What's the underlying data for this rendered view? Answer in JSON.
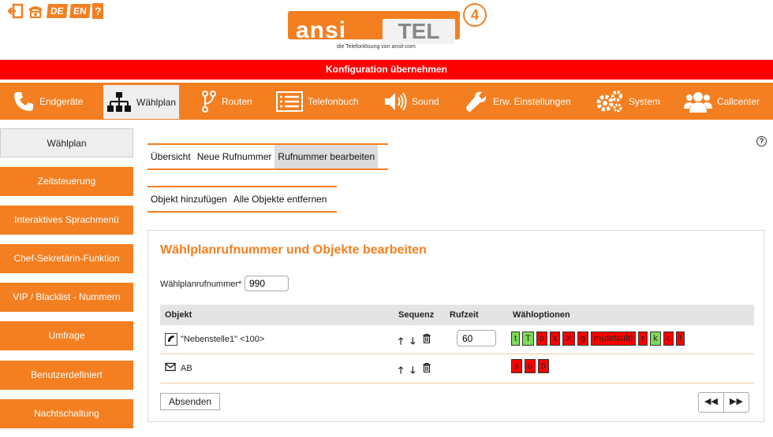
{
  "top_icons": {
    "lang_de": "DE",
    "lang_en": "EN",
    "help": "?"
  },
  "logo": {
    "ansi": "ansi",
    "tel": "TEL",
    "version": "4",
    "subline": "die Telefonlösung von ansit-com"
  },
  "apply_bar": "Konfiguration übernehmen",
  "nav": [
    {
      "label": "Endgeräte",
      "icon": "phone-icon"
    },
    {
      "label": "Wählplan",
      "icon": "hierarchy-icon"
    },
    {
      "label": "Routen",
      "icon": "route-icon"
    },
    {
      "label": "Telefonbuch",
      "icon": "list-icon"
    },
    {
      "label": "Sound",
      "icon": "speaker-icon"
    },
    {
      "label": "Erw. Einstellungen",
      "icon": "wrench-icon"
    },
    {
      "label": "System",
      "icon": "gears-icon"
    },
    {
      "label": "Callcenter",
      "icon": "users-icon"
    }
  ],
  "sidebar": [
    "Wählplan",
    "Zeitsteuerung",
    "Interaktives Sprachmenü",
    "Chef-Sekretärin-Funktion",
    "VIP / Blacklist - Nummern",
    "Umfrage",
    "Benutzerdefiniert",
    "Nachtschaltung"
  ],
  "tabs1": [
    "Übersicht",
    "Neue Rufnummer",
    "Rufnummer bearbeiten"
  ],
  "tabs2": [
    "Objekt hinzufügen",
    "Alle Objekte entfernen"
  ],
  "help_icon": "?",
  "panel": {
    "title": "Wählplanrufnummer und Objekte bearbeiten",
    "number_label": "Wählplanrufnummer*",
    "number_value": "990",
    "columns": {
      "objekt": "Objekt",
      "sequenz": "Sequenz",
      "rufzeit": "Rufzeit",
      "wahloptionen": "Wähloptionen"
    },
    "rows": [
      {
        "icon": "phone-handset-icon",
        "name": "\"Nebenstelle1\" <100>",
        "rufzeit": "60",
        "options": [
          {
            "label": "t",
            "color": "#7ed957"
          },
          {
            "label": "T",
            "color": "#7ed957"
          },
          {
            "label": "o",
            "color": "#ff0000"
          },
          {
            "label": "x",
            "color": "#ff0000"
          },
          {
            "label": "X",
            "color": "#ff0000"
          },
          {
            "label": "g",
            "color": "#ff0000"
          },
          {
            "label": "m(default)",
            "color": "#ff0000"
          },
          {
            "label": "r",
            "color": "#ff0000"
          },
          {
            "label": "k",
            "color": "#7ed957"
          },
          {
            "label": "c",
            "color": "#ff0000"
          },
          {
            "label": "f",
            "color": "#ff0000"
          }
        ]
      },
      {
        "icon": "envelope-icon",
        "name": "AB",
        "rufzeit": "",
        "options": [
          {
            "label": "s",
            "color": "#ff0000"
          },
          {
            "label": "u",
            "color": "#ff0000"
          },
          {
            "label": "b",
            "color": "#ff0000"
          }
        ]
      }
    ],
    "submit": "Absenden",
    "pager_prev": "◀◀",
    "pager_next": "▶▶"
  },
  "colors": {
    "accent": "#f47f20",
    "alert": "#ff0000"
  }
}
